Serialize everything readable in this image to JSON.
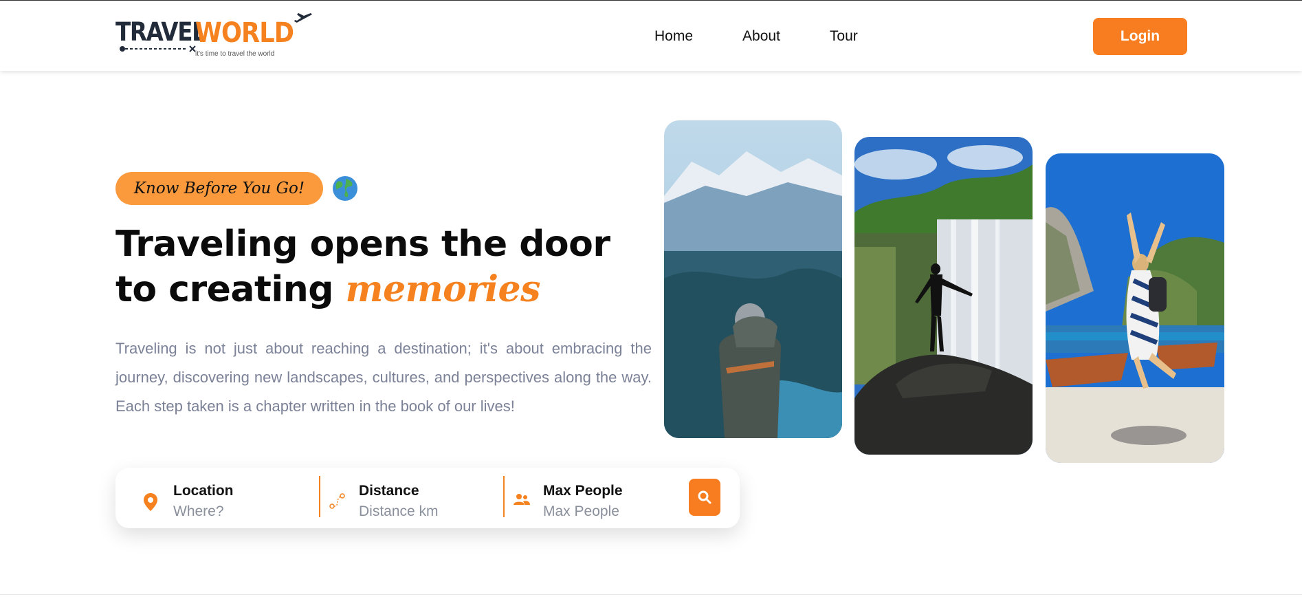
{
  "header": {
    "logo": {
      "brand_part1": "TRAVEL",
      "brand_part2": "WORLD",
      "tagline": "it's time to travel the world"
    },
    "nav": [
      {
        "label": "Home"
      },
      {
        "label": "About"
      },
      {
        "label": "Tour"
      }
    ],
    "login_label": "Login"
  },
  "hero": {
    "badge": "Know Before You Go!",
    "badge_emoji": "🌍",
    "headline_main": "Traveling opens the door to creating",
    "headline_accent": "memories",
    "description": "Traveling is not just about reaching a destination; it's about embracing the journey, discovering new landscapes, cultures, and perspectives along the way. Each step taken is a chapter written in the book of our lives!"
  },
  "search": {
    "location": {
      "label": "Location",
      "placeholder": "Where?",
      "icon": "map-pin-icon"
    },
    "distance": {
      "label": "Distance",
      "placeholder": "Distance km",
      "icon": "route-icon"
    },
    "people": {
      "label": "Max People",
      "placeholder": "Max People",
      "icon": "people-icon"
    },
    "button_icon": "search-icon"
  },
  "images": [
    {
      "name": "hero-photo-mountain-hiker"
    },
    {
      "name": "hero-photo-waterfall"
    },
    {
      "name": "hero-photo-beach-jump"
    }
  ],
  "colors": {
    "accent": "#f87d20",
    "badge": "#fb9a3c",
    "text_dark": "#0b0b0b",
    "text_muted": "#7b8196",
    "logo_dark": "#222b3a"
  }
}
